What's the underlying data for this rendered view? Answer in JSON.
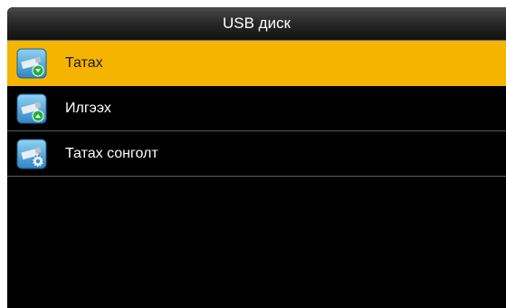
{
  "header": {
    "title": "USB диск"
  },
  "menu": {
    "items": [
      {
        "label": "Татах",
        "icon": "usb-download-icon",
        "selected": true
      },
      {
        "label": "Илгээх",
        "icon": "usb-upload-icon",
        "selected": false
      },
      {
        "label": "Татах сонголт",
        "icon": "usb-settings-icon",
        "selected": false
      }
    ]
  },
  "colors": {
    "highlight": "#f4b400",
    "background": "#000000",
    "icon_tile": "#4fa8d8",
    "download_arrow": "#22b33a",
    "upload_arrow": "#22b33a",
    "settings_gear": "#3a8fd0"
  }
}
